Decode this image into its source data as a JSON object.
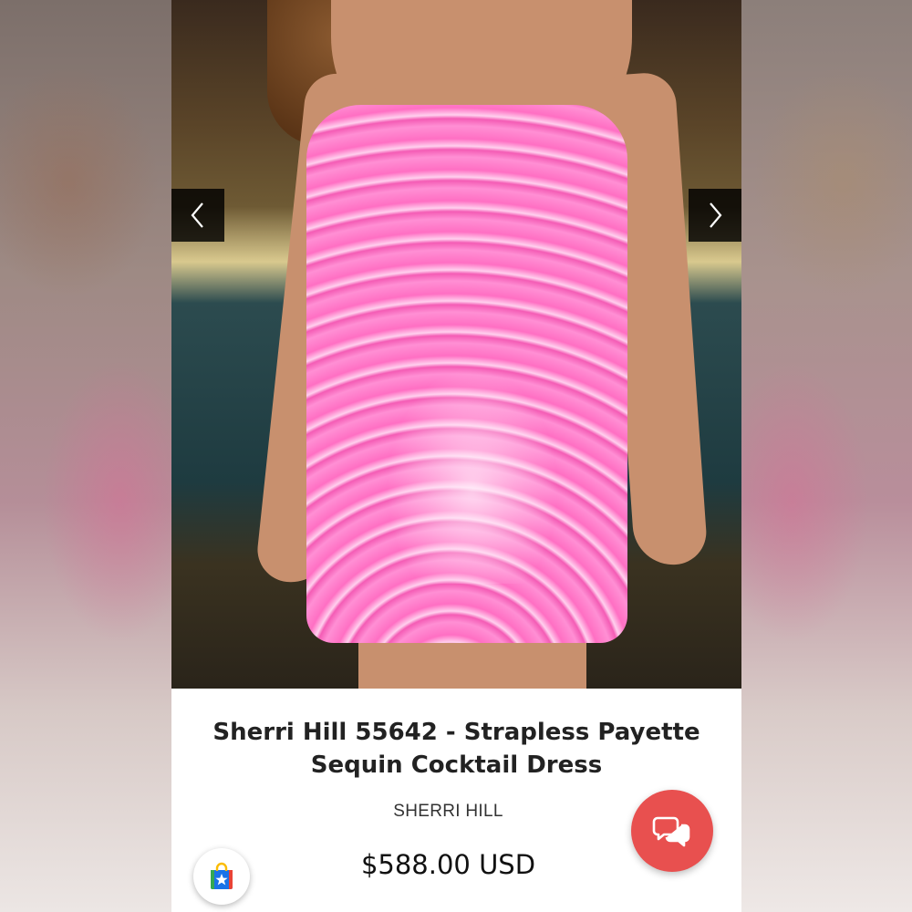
{
  "product": {
    "title": "Sherri Hill 55642 - Strapless Payette Sequin Cocktail Dress",
    "brand": "SHERRI HILL",
    "price": "$588.00 USD"
  },
  "gallery": {
    "image_subject": "pink-sequin-strapless-dress-photo",
    "prev_icon": "chevron-left-icon",
    "next_icon": "chevron-right-icon"
  },
  "floating_buttons": {
    "chat_icon": "chat-bubbles-icon",
    "shop_icon": "shopping-bag-star-icon"
  },
  "colors": {
    "chat_button": "#e8504f",
    "dress_pink": "#ff6fc3",
    "arrow_background": "#000000"
  }
}
